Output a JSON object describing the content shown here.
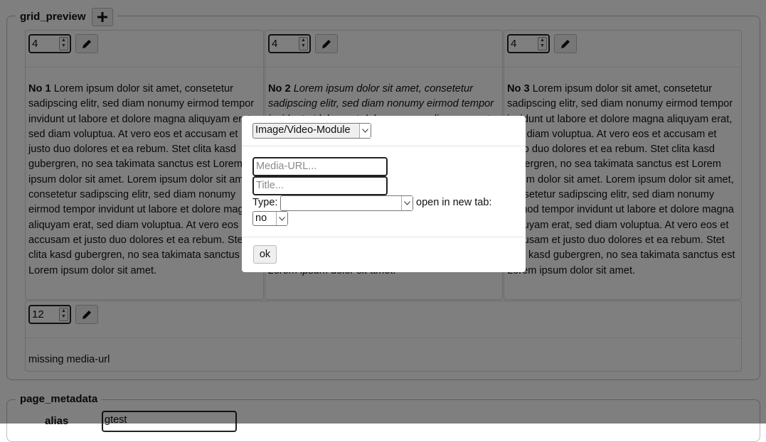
{
  "grid_preview": {
    "legend": "grid_preview",
    "add_icon": "plus-icon",
    "cells": [
      {
        "width_value": "4",
        "label": "No 1",
        "text": "Lorem ipsum dolor sit amet, consetetur sadipscing elitr, sed diam nonumy eirmod tempor invidunt ut labore et dolore magna aliquyam erat, sed diam voluptua. At vero eos et accusam et justo duo dolores et ea rebum. Stet clita kasd gubergren, no sea takimata sanctus est Lorem ipsum dolor sit amet. Lorem ipsum dolor sit amet, consetetur sadipscing elitr, sed diam nonumy eirmod tempor invidunt ut labore et dolore magna aliquyam erat, sed diam voluptua. At vero eos et accusam et justo duo dolores et ea rebum. Stet clita kasd gubergren, no sea takimata sanctus est Lorem ipsum dolor sit amet."
      },
      {
        "width_value": "4",
        "label": "No 2",
        "text": "Lorem ipsum dolor sit amet, consetetur sadipscing elitr, sed diam nonumy eirmod tempor invidunt ut labore et dolore magna aliquyam erat, sed diam voluptua. At vero eos et accusam et justo duo dolores et ea rebum. Stet clita kasd gubergren, no sea takimata sanctus est Lorem ipsum dolor sit amet. Lorem ipsum dolor sit amet, consetetur sadipscing elitr, sed diam nonumy eirmod tempor invidunt ut labore et dolore magna aliquyam erat, sed diam voluptua. At vero eos et accusam et justo duo dolores et ea rebum. Stet clita kasd gubergren, no sea takimata sanctus est Lorem ipsum dolor sit amet."
      },
      {
        "width_value": "4",
        "label": "No 3",
        "text": "Lorem ipsum dolor sit amet, consetetur sadipscing elitr, sed diam nonumy eirmod tempor invidunt ut labore et dolore magna aliquyam erat, sed diam voluptua. At vero eos et accusam et justo duo dolores et ea rebum. Stet clita kasd gubergren, no sea takimata sanctus est Lorem ipsum dolor sit amet. Lorem ipsum dolor sit amet, consetetur sadipscing elitr, sed diam nonumy eirmod tempor invidunt ut labore et dolore magna aliquyam erat, sed diam voluptua. At vero eos et accusam et justo duo dolores et ea rebum. Stet clita kasd gubergren, no sea takimata sanctus est Lorem ipsum dolor sit amet."
      },
      {
        "width_value": "12",
        "text": "missing media-url"
      }
    ]
  },
  "page_metadata": {
    "legend": "page_metadata",
    "alias_label": "alias",
    "alias_value": "gtest"
  },
  "modal": {
    "module_select": "Image/Video-Module",
    "media_url_placeholder": "Media-URL...",
    "title_placeholder": "Title...",
    "type_label": "Type:",
    "type_value": "",
    "new_tab_label": "open in new tab:",
    "new_tab_value": "no",
    "ok_label": "ok"
  },
  "icons": {
    "edit": "pencil-icon",
    "spin": "spinner-arrows-icon",
    "dropdown": "chevron-down-icon"
  },
  "colors": {
    "overlay": "#000000",
    "modal_bg": "#ffffff"
  }
}
